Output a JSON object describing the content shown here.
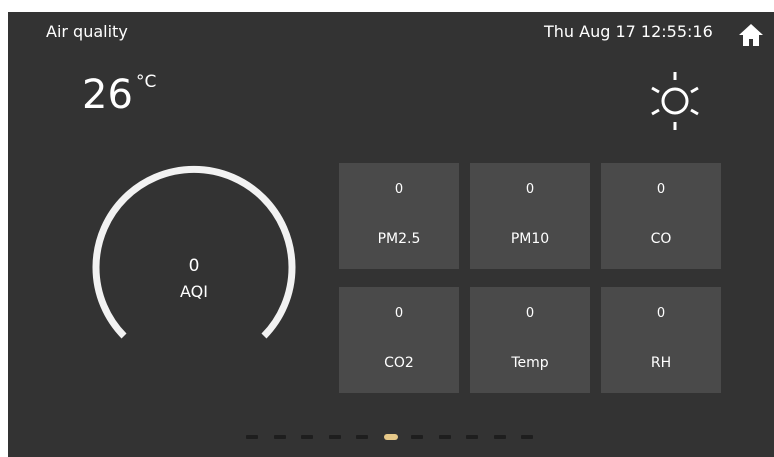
{
  "header": {
    "title": "Air quality",
    "datetime": "Thu Aug 17  12:55:16",
    "home_icon": "home-icon"
  },
  "weather": {
    "temperature": "26",
    "unit": "°C",
    "icon": "sun-icon"
  },
  "aqi": {
    "value": "0",
    "label": "AQI"
  },
  "sensors": [
    {
      "value": "0",
      "label": "PM2.5"
    },
    {
      "value": "0",
      "label": "PM10"
    },
    {
      "value": "0",
      "label": "CO"
    },
    {
      "value": "0",
      "label": "CO2"
    },
    {
      "value": "0",
      "label": "Temp"
    },
    {
      "value": "0",
      "label": "RH"
    }
  ],
  "pager": {
    "count": 11,
    "active_index": 5
  },
  "colors": {
    "background": "#333333",
    "tile": "#4a4a4a",
    "active_page": "#e6c889",
    "text": "#ffffff"
  }
}
